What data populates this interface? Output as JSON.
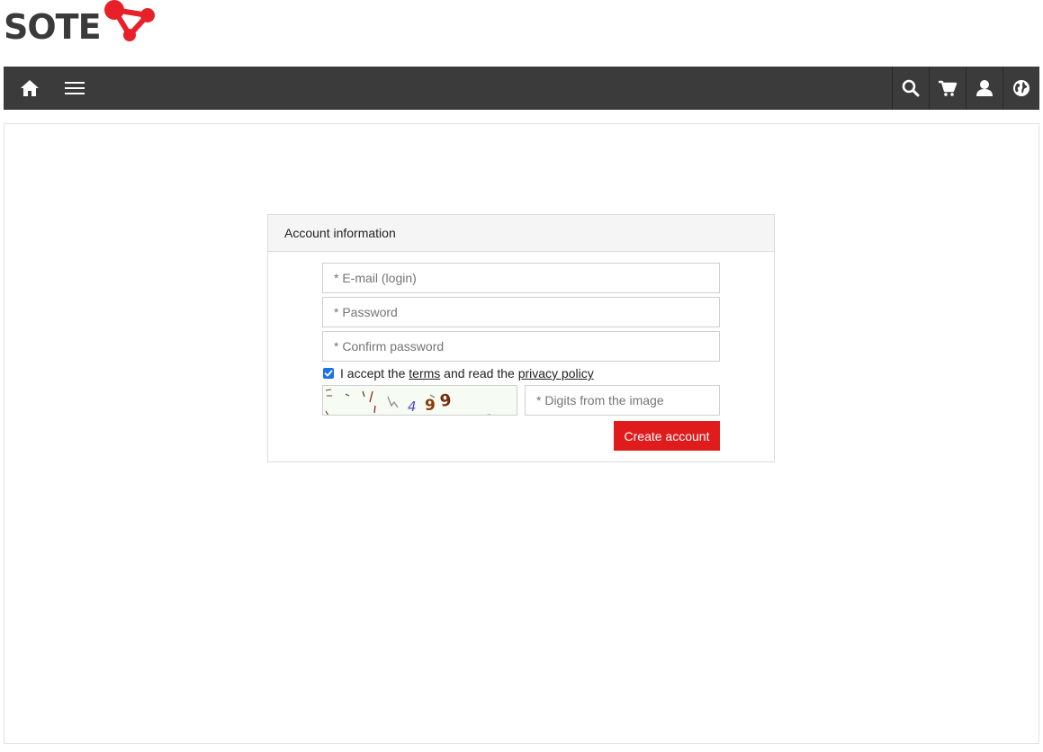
{
  "brand": {
    "logo_text": "SOTE",
    "accent_color": "#e8202a"
  },
  "navbar": {
    "left_icons": [
      "home-icon",
      "menu-icon"
    ],
    "right_icons": [
      "search-icon",
      "cart-icon",
      "user-icon",
      "globe-icon"
    ],
    "background": "#3b3b3b"
  },
  "form": {
    "header": "Account information",
    "email_placeholder": "* E-mail (login)",
    "password_placeholder": "* Password",
    "confirm_placeholder": "* Confirm password",
    "terms": {
      "checked": true,
      "prefix": "I accept the",
      "terms_link": "terms",
      "middle": "and read the",
      "privacy_link": "privacy policy"
    },
    "captcha_placeholder": "* Digits from the image",
    "submit_label": "Create account",
    "submit_color": "#e01b1b"
  }
}
